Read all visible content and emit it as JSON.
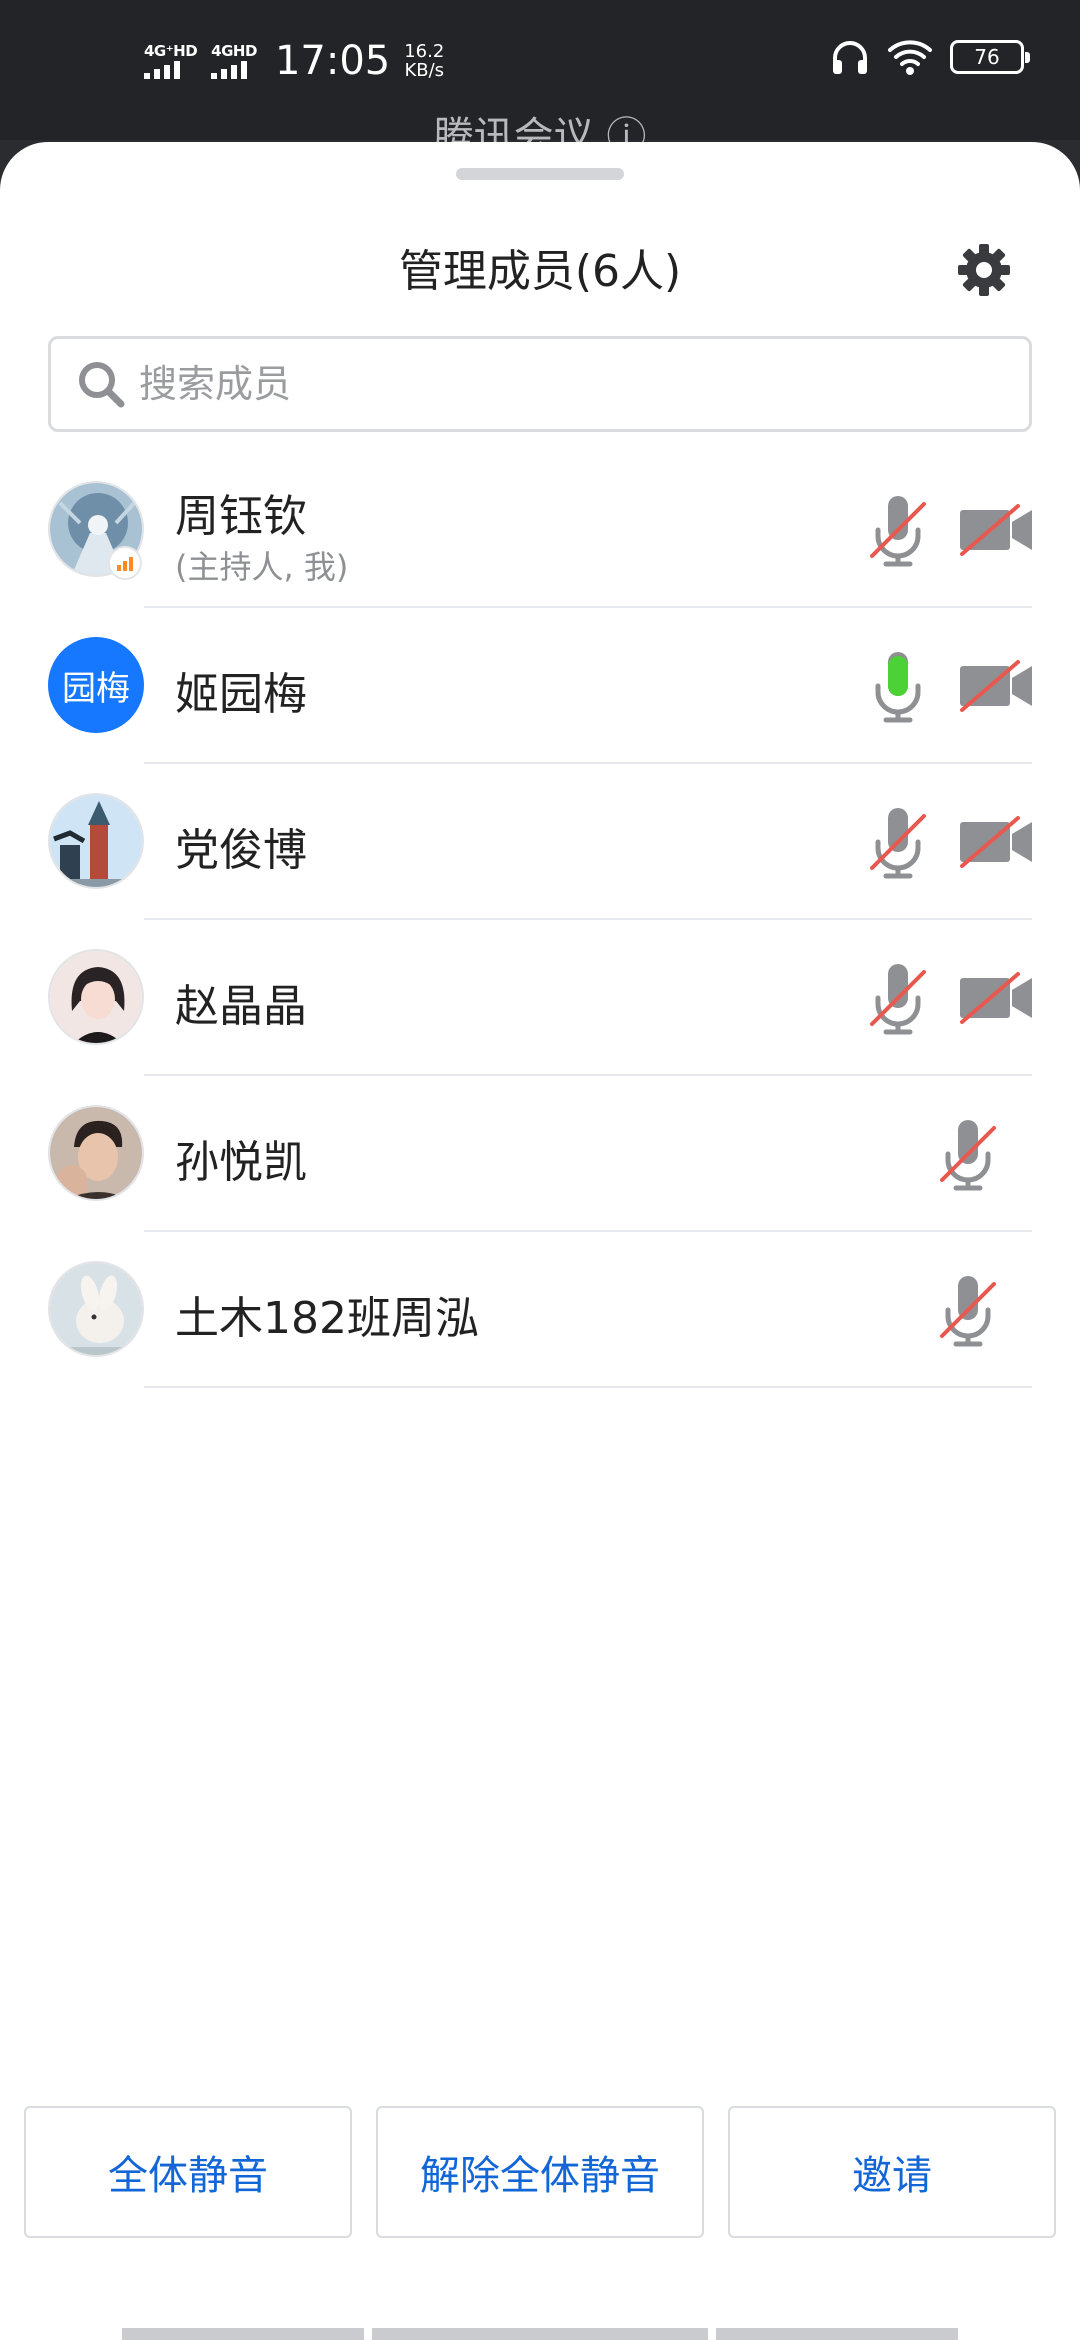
{
  "status_bar": {
    "network_1": "4G⁺HD",
    "network_2": "4GHD",
    "time": "17:05",
    "speed_value": "16.2",
    "speed_unit": "KB/s",
    "battery": "76"
  },
  "meeting": {
    "title": "腾讯会议 ⓘ"
  },
  "panel": {
    "title": "管理成员(6人)",
    "search_placeholder": "搜索成员"
  },
  "members": [
    {
      "name": "周钰钦",
      "role": "(主持人, 我)",
      "mic": "muted",
      "camera": "off"
    },
    {
      "name": "姬园梅",
      "avatar_text": "园梅",
      "avatar_color": "#1677ff",
      "mic": "active",
      "camera": "off"
    },
    {
      "name": "党俊博",
      "mic": "muted",
      "camera": "off"
    },
    {
      "name": "赵晶晶",
      "mic": "muted",
      "camera": "off"
    },
    {
      "name": "孙悦凯",
      "mic": "muted"
    },
    {
      "name": "土木182班周泓",
      "mic": "muted"
    }
  ],
  "actions": {
    "mute_all": "全体静音",
    "unmute_all": "解除全体静音",
    "invite": "邀请"
  },
  "colors": {
    "accent": "#1266d6",
    "mic_active": "#4cd137",
    "muted_slash": "#e8584f",
    "icon_gray": "#8e9094"
  }
}
